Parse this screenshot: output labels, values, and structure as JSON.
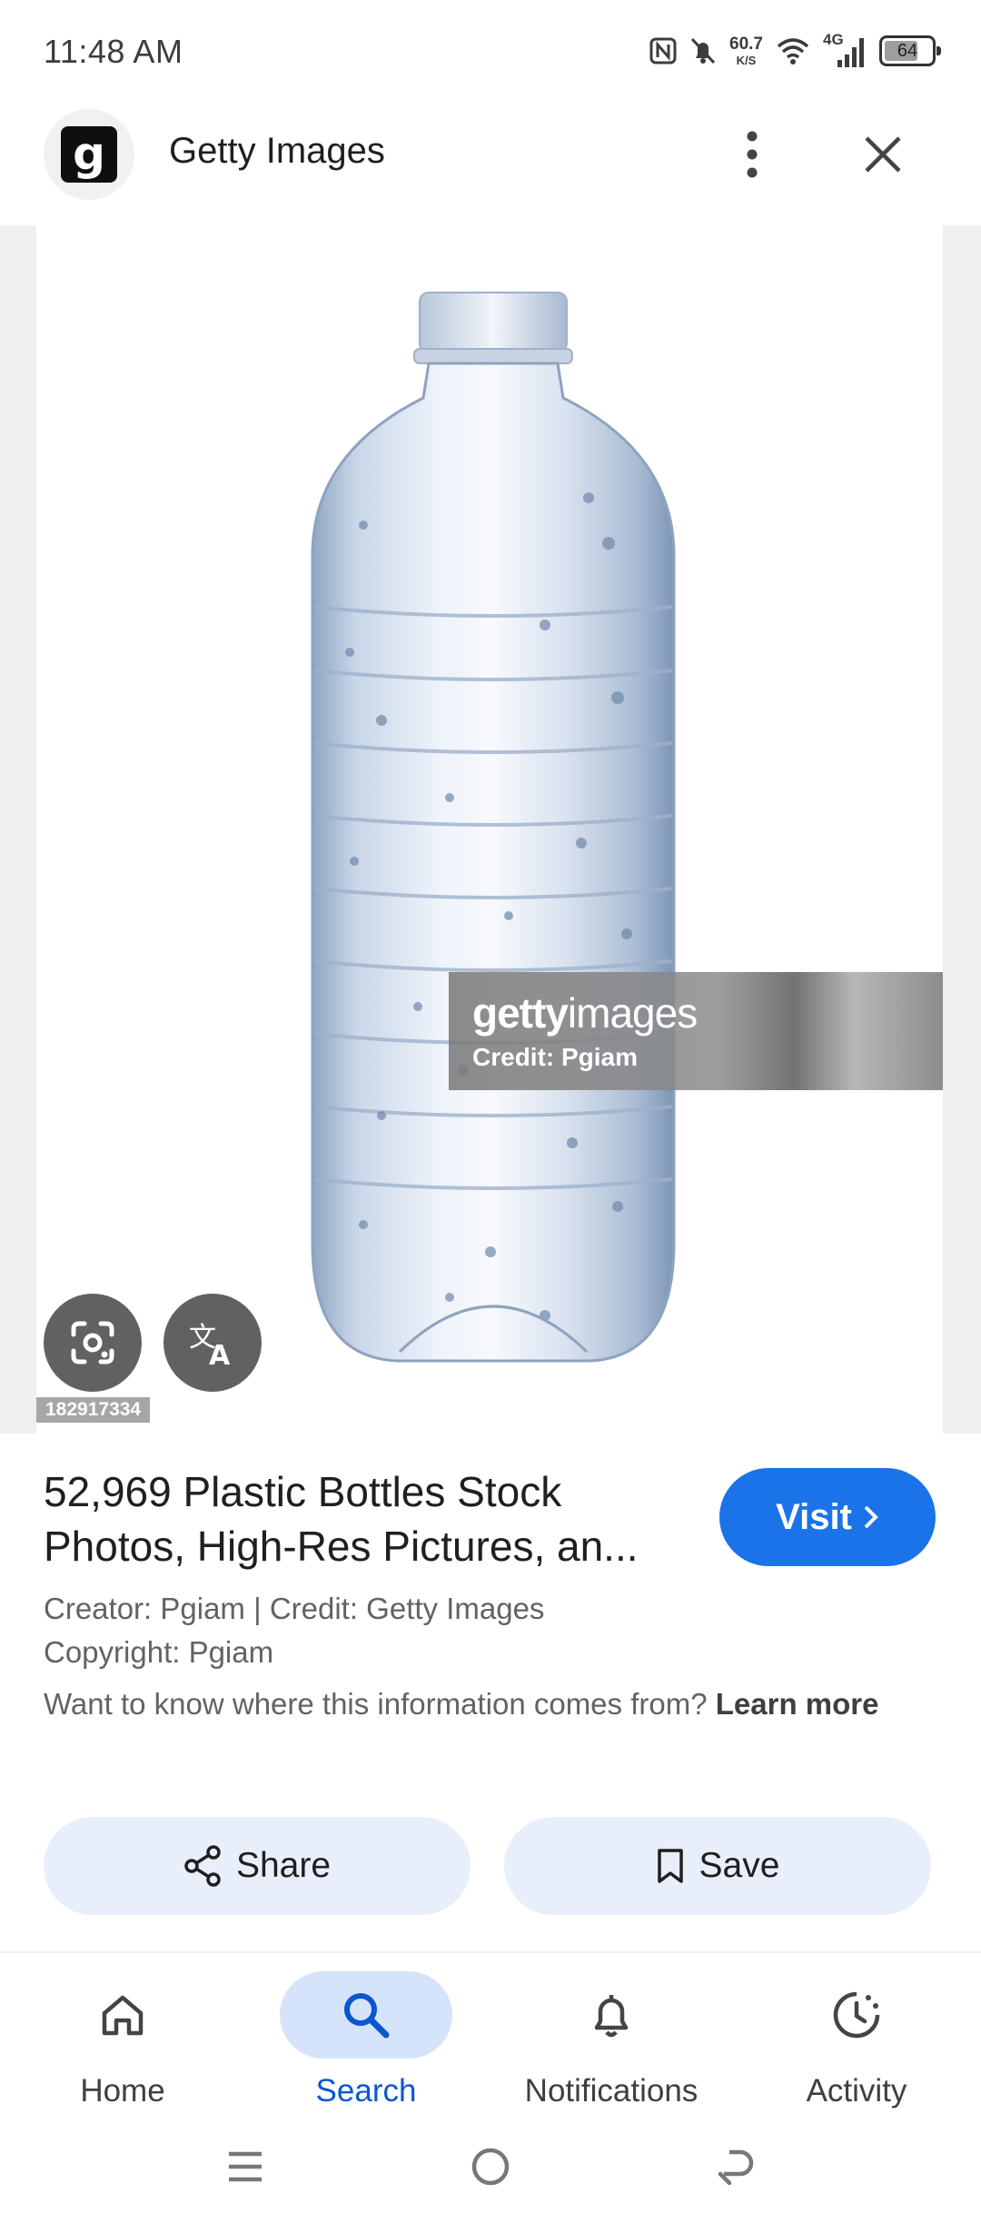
{
  "status_bar": {
    "time": "11:48 AM",
    "speed_value": "60.7",
    "speed_unit": "K/S",
    "network": "4G",
    "battery": "64",
    "battery_level": 0.64
  },
  "header": {
    "logo_letter": "g",
    "site_name": "Getty Images"
  },
  "image": {
    "watermark_brand_bold": "getty",
    "watermark_brand_light": "images",
    "watermark_credit": "Credit: Pgiam",
    "image_id": "182917334"
  },
  "result": {
    "title": "52,969 Plastic Bottles Stock Photos, High-Res Pictures, an...",
    "visit_label": "Visit",
    "creator_line": "Creator: Pgiam | Credit: Getty Images",
    "copyright_line": "Copyright: Pgiam",
    "info_text": "Want to know where this information comes from?",
    "learn_more": "Learn more"
  },
  "actions": {
    "share_label": "Share",
    "save_label": "Save"
  },
  "bottom_nav": {
    "items": [
      {
        "label": "Home",
        "icon": "home-icon"
      },
      {
        "label": "Search",
        "icon": "search-icon",
        "active": true
      },
      {
        "label": "Notifications",
        "icon": "bell-icon"
      },
      {
        "label": "Activity",
        "icon": "activity-icon"
      }
    ]
  },
  "colors": {
    "accent": "#1a73e8",
    "pill_bg": "#e8effb",
    "active_nav": "#0b57d0"
  }
}
